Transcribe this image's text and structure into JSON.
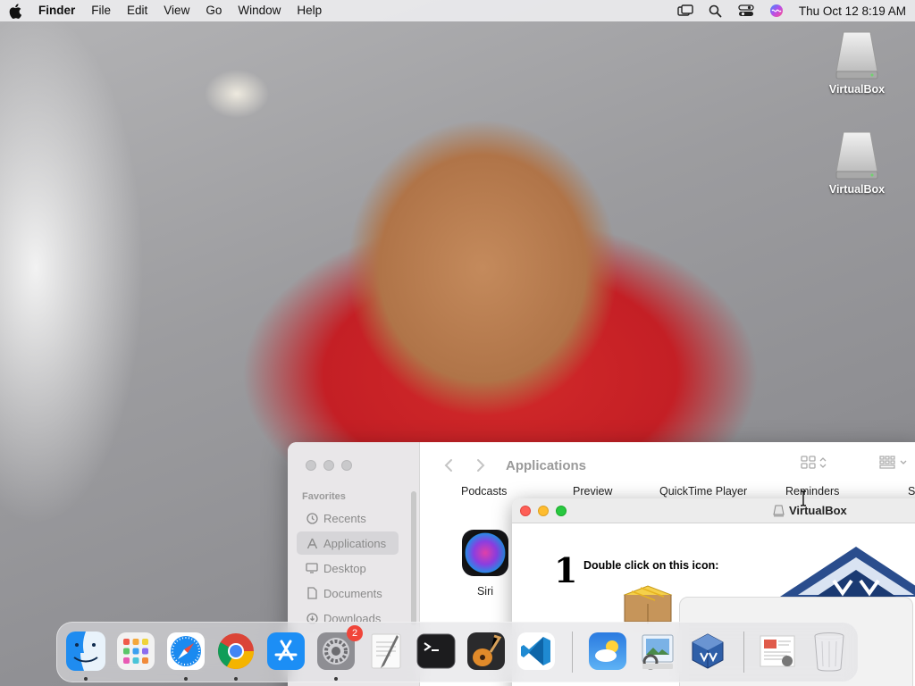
{
  "menubar": {
    "app_name": "Finder",
    "menus": [
      "File",
      "Edit",
      "View",
      "Go",
      "Window",
      "Help"
    ],
    "clock": "Thu Oct 12  8:19 AM",
    "status_icons": [
      "screen-mirroring-icon",
      "spotlight-search-icon",
      "control-center-icon",
      "siri-icon"
    ]
  },
  "desktop": {
    "icons": [
      {
        "label": "VirtualBox",
        "icon": "disk-image-icon"
      },
      {
        "label": "VirtualBox",
        "icon": "disk-image-icon"
      }
    ]
  },
  "finder": {
    "title": "Applications",
    "sidebar_heading": "Favorites",
    "sidebar_items": [
      {
        "label": "Recents",
        "icon": "clock-icon"
      },
      {
        "label": "Applications",
        "icon": "applications-icon"
      },
      {
        "label": "Desktop",
        "icon": "desktop-icon"
      },
      {
        "label": "Documents",
        "icon": "document-icon"
      },
      {
        "label": "Downloads",
        "icon": "downloads-icon"
      }
    ],
    "selected_sidebar_item": "Applications",
    "app_labels_top": [
      "Podcasts",
      "Preview",
      "QuickTime Player",
      "Reminders",
      "S"
    ],
    "app_visible": {
      "label": "Siri",
      "icon": "siri-icon"
    }
  },
  "vbox_installer": {
    "title": "VirtualBox",
    "step_number": "1",
    "step_text": "Double click on this icon:"
  },
  "dock": {
    "items": [
      {
        "name": "Finder",
        "icon": "finder-icon",
        "running": true
      },
      {
        "name": "Launchpad",
        "icon": "launchpad-icon",
        "running": false
      },
      {
        "name": "Safari",
        "icon": "safari-icon",
        "running": true
      },
      {
        "name": "Google Chrome",
        "icon": "chrome-icon",
        "running": true
      },
      {
        "name": "App Store",
        "icon": "app-store-icon",
        "running": false
      },
      {
        "name": "System Settings",
        "icon": "settings-icon",
        "running": true,
        "badge": "2"
      },
      {
        "name": "TextEdit",
        "icon": "textedit-icon",
        "running": false
      },
      {
        "name": "Terminal",
        "icon": "terminal-icon",
        "running": false
      },
      {
        "name": "GarageBand",
        "icon": "garageband-icon",
        "running": false
      },
      {
        "name": "Visual Studio Code",
        "icon": "vscode-icon",
        "running": false
      },
      {
        "name": "Weather",
        "icon": "weather-icon",
        "running": false
      },
      {
        "name": "Preview",
        "icon": "preview-icon",
        "running": false
      },
      {
        "name": "VirtualBox",
        "icon": "virtualbox-icon",
        "running": false
      },
      {
        "name": "Downloads",
        "icon": "downloads-stack-icon",
        "running": false
      },
      {
        "name": "Trash",
        "icon": "trash-icon",
        "running": false
      }
    ]
  },
  "colors": {
    "menubar_bg": "#ececee",
    "close": "#fe5f57",
    "minimize": "#febc2e",
    "zoom": "#28c840",
    "badge": "#f0453a",
    "vbox_blue": "#1b3a72"
  }
}
